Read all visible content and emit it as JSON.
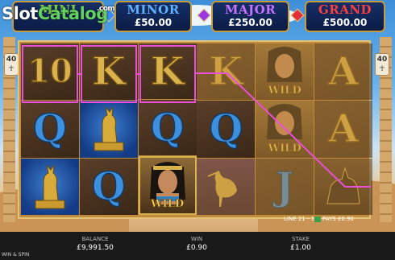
{
  "watermark": {
    "part1": "Slot",
    "part2": "Catalog",
    "part3": ".com"
  },
  "jackpots": [
    {
      "title": "MINI",
      "amount": "",
      "color": "#7fd13a"
    },
    {
      "title": "MINOR",
      "amount": "£50.00",
      "color": "#5fb0ff"
    },
    {
      "title": "MAJOR",
      "amount": "£250.00",
      "color": "#c872ff"
    },
    {
      "title": "GRAND",
      "amount": "£500.00",
      "color": "#ff3f3f"
    }
  ],
  "paylines": {
    "left_count": "40",
    "right_count": "40"
  },
  "reels": [
    [
      "10",
      "Q",
      "cat-statue"
    ],
    [
      "K",
      "cat-statue",
      "Q"
    ],
    [
      "K",
      "Q",
      "cleopatra-wild"
    ],
    [
      "K",
      "Q",
      "ibis"
    ],
    [
      "cleopatra-wild",
      "cleopatra-wild",
      "J"
    ],
    [
      "A",
      "A",
      "jackal"
    ]
  ],
  "wild_label": "WILD",
  "info": {
    "line_win": "LINE 21 - 10",
    "pays": "PAYS £0.90"
  },
  "bottom": {
    "balance_label": "BALANCE",
    "balance_value": "£9,991.50",
    "win_label": "WIN",
    "win_value": "£0.90",
    "stake_label": "STAKE",
    "stake_value": "£1.00",
    "spin_label": "WIN & SPIN"
  },
  "colors": {
    "win_highlight": "#e94fd7",
    "gold": "#d9b24d",
    "blue_symbol": "#3e8fdc"
  }
}
